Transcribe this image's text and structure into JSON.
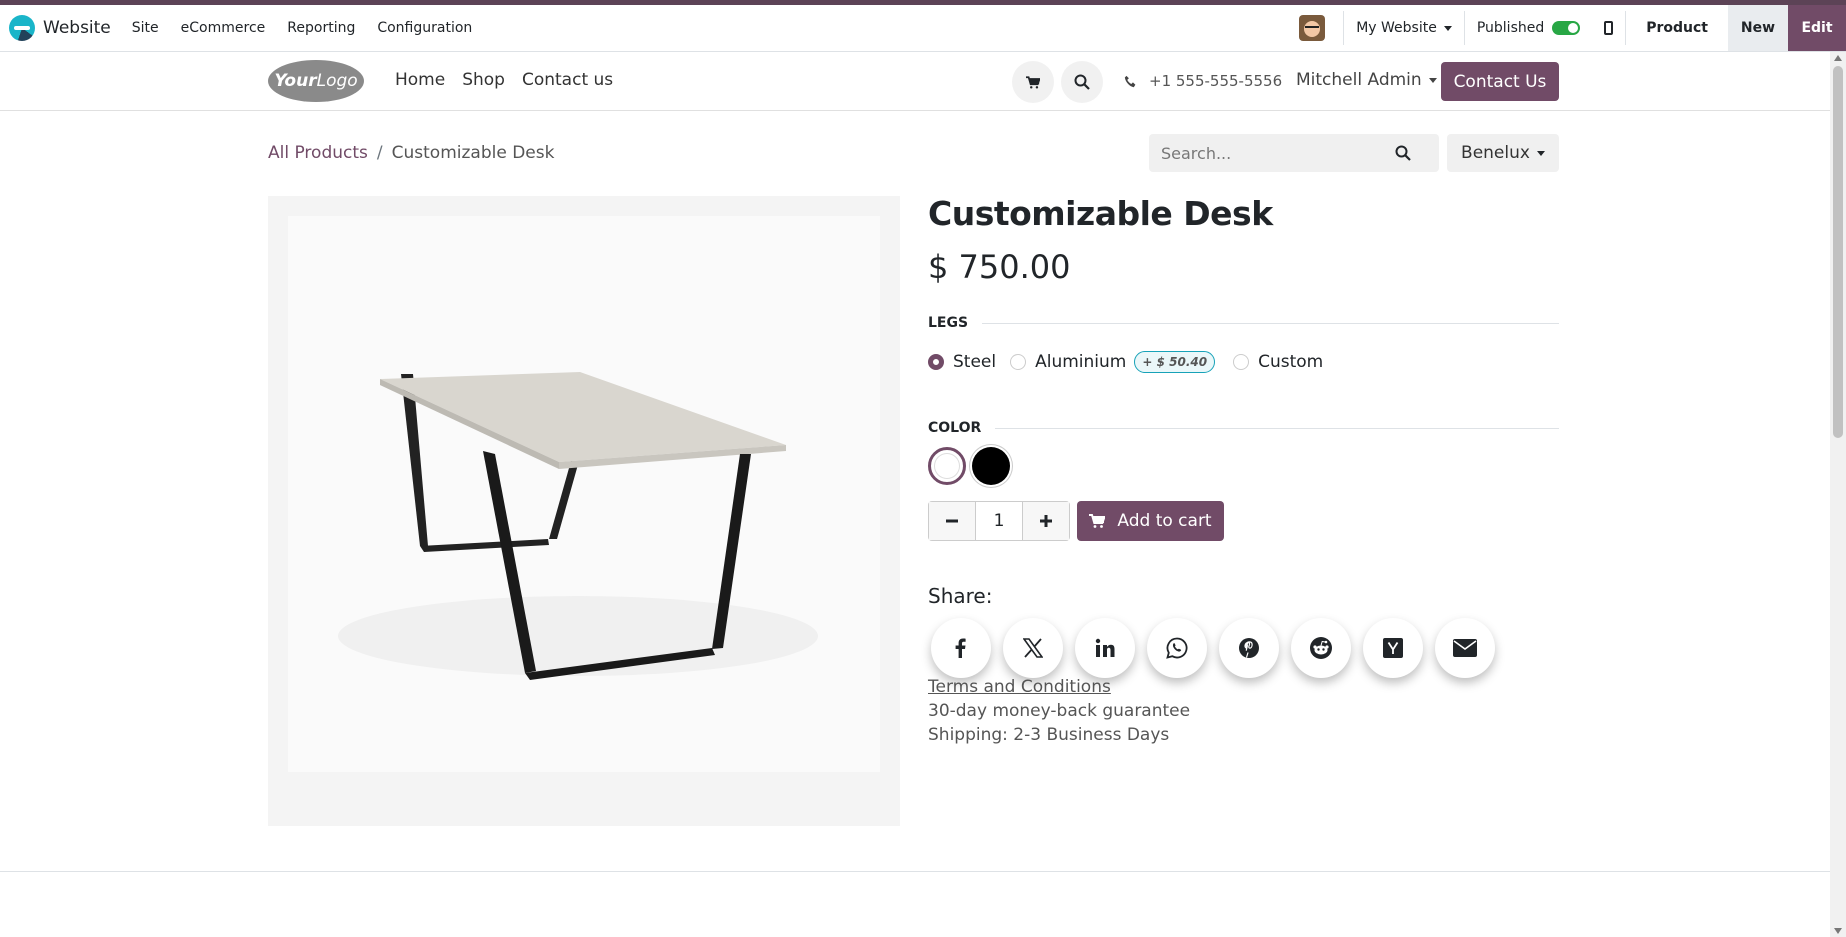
{
  "admin_bar": {
    "app_name": "Website",
    "menu": [
      "Site",
      "eCommerce",
      "Reporting",
      "Configuration"
    ],
    "website_selector": "My Website",
    "published_label": "Published",
    "published": true,
    "product_label": "Product",
    "new_label": "New",
    "edit_label": "Edit"
  },
  "header": {
    "logo_bold": "Your",
    "logo_text": "Logo",
    "nav": [
      "Home",
      "Shop",
      "Contact us"
    ],
    "phone": "+1 555-555-5556",
    "user": "Mitchell Admin",
    "contact_button": "Contact Us"
  },
  "breadcrumb": {
    "parent": "All Products",
    "separator": "/",
    "current": "Customizable Desk"
  },
  "search": {
    "placeholder": "Search..."
  },
  "pricelist": "Benelux",
  "product": {
    "name": "Customizable Desk",
    "price": "$ 750.00",
    "legs_label": "LEGS",
    "legs_options": [
      {
        "label": "Steel",
        "selected": true
      },
      {
        "label": "Aluminium",
        "extra": "+ $ 50.40"
      },
      {
        "label": "Custom"
      }
    ],
    "color_label": "COLOR",
    "colors": [
      {
        "name": "white",
        "hex": "#ffffff",
        "selected": true
      },
      {
        "name": "black",
        "hex": "#000000"
      }
    ],
    "quantity": "1",
    "add_to_cart": "Add to cart",
    "share_label": "Share:",
    "share_icons": [
      "facebook-icon",
      "x-icon",
      "linkedin-icon",
      "whatsapp-icon",
      "pinterest-icon",
      "reddit-icon",
      "hackernews-icon",
      "email-icon"
    ],
    "terms": "Terms and Conditions",
    "guarantee": "30-day money-back guarantee",
    "shipping": "Shipping: 2-3 Business Days"
  },
  "colors": {
    "accent": "#714b67",
    "toggle_on": "#28a745"
  }
}
